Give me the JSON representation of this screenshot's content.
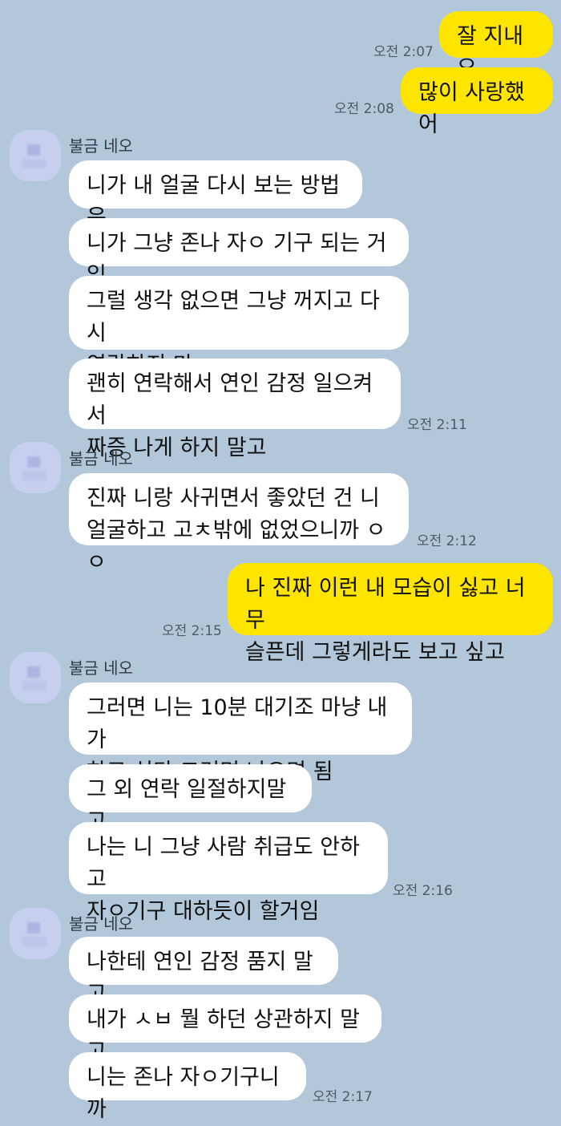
{
  "sender_name": "불금 네오",
  "messages": {
    "out1": {
      "text": "잘 지내요",
      "time": "오전 2:07"
    },
    "out2": {
      "text": "많이 사랑했어",
      "time": "오전 2:08"
    },
    "g1": [
      "니가 내 얼굴 다시 보는 방법은",
      "니가 그냥 존나 자ㅇ 기구 되는 거임",
      "그럴 생각 없으면 그냥 꺼지고 다시\n연락하지 마",
      "괜히 연락해서 연인 감정 일으켜서\n짜증 나게 하지 말고"
    ],
    "g1_time": "오전 2:11",
    "g2": [
      "진짜 니랑 사귀면서 좋았던 건 니\n얼굴하고 고ㅊ밖에 없었으니까 ㅇㅇ"
    ],
    "g2_time": "오전 2:12",
    "out3": {
      "text": "나 진짜 이런 내 모습이 싫고 너무\n슬픈데 그렇게라도 보고 싶고",
      "time": "오전 2:15"
    },
    "g3": [
      "그러면 니는 10분 대기조 마냥 내가\n하고 싶다 그러면 나오면 됨",
      "그 외 연락 일절하지말고",
      "나는 니 그냥 사람 취급도 안하고\n자ㅇ기구 대하듯이 할거임"
    ],
    "g3_time": "오전 2:16",
    "g4": [
      "나한테 연인 감정 품지 말고",
      "내가 ㅅㅂ 뭘 하던 상관하지 말고",
      "니는 존나 자ㅇ기구니까"
    ],
    "g4_time": "오전 2:17"
  },
  "colors": {
    "background": "#b2c7da",
    "outgoing_bubble": "#fee500",
    "incoming_bubble": "#ffffff"
  },
  "icons": {
    "avatar": "blurred-profile-avatar-icon"
  }
}
